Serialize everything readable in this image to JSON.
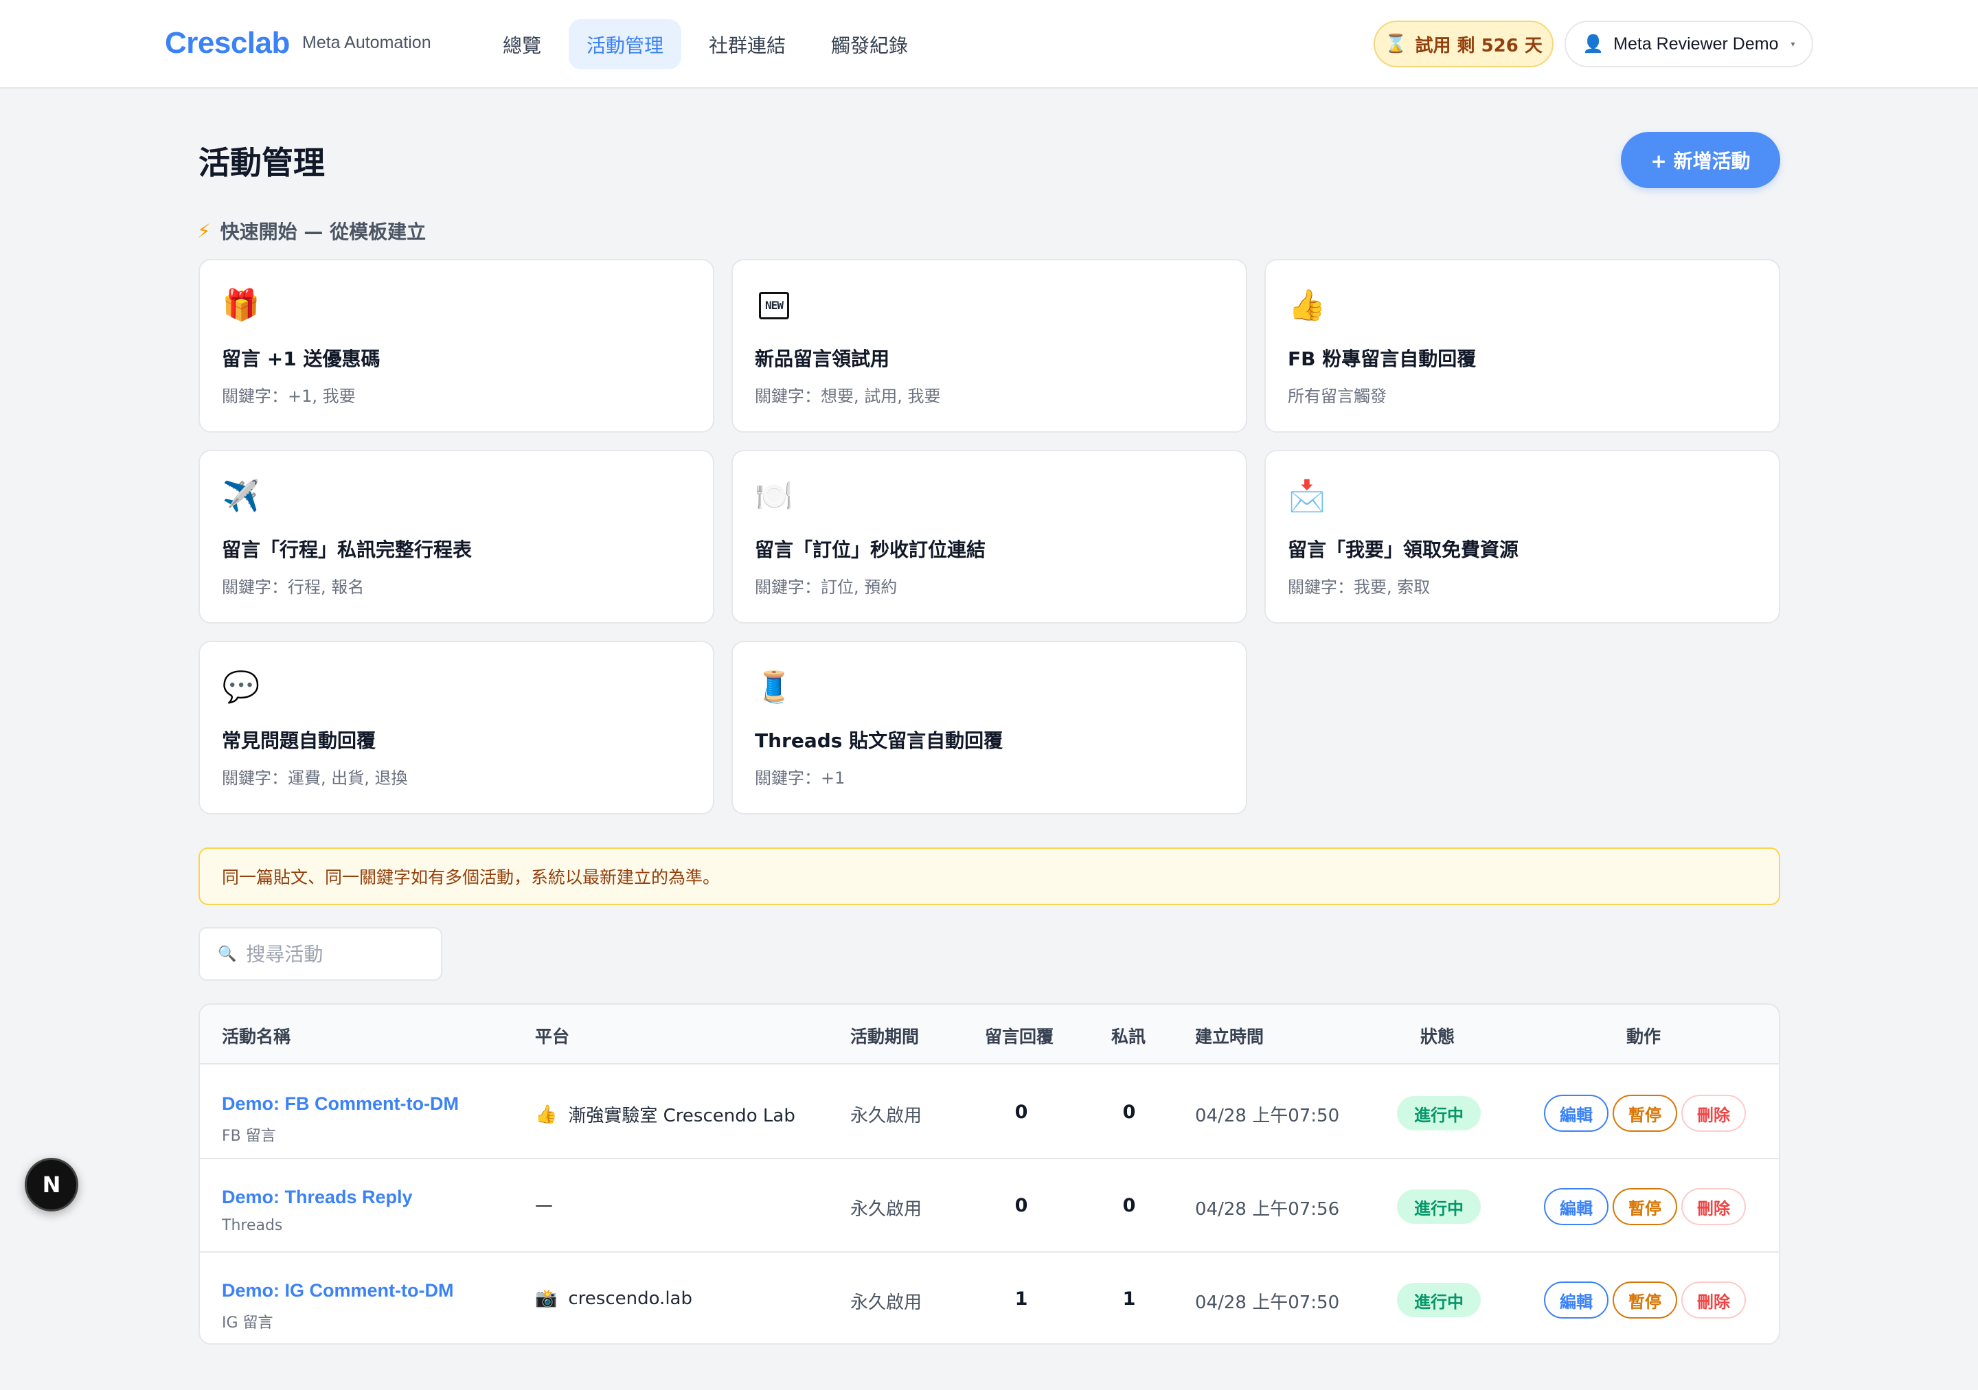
{
  "header": {
    "logo": "Cresclab",
    "logo_sub": "Meta Automation",
    "nav": [
      {
        "label": "總覽",
        "active": false
      },
      {
        "label": "活動管理",
        "active": true
      },
      {
        "label": "社群連結",
        "active": false
      },
      {
        "label": "觸發紀錄",
        "active": false
      }
    ],
    "trial_icon": "⌛",
    "trial_label": "試用 剩 526 天",
    "user_icon": "👤",
    "user_name": "Meta Reviewer Demo",
    "user_caret": "▾"
  },
  "page": {
    "title": "活動管理",
    "new_button": "+ 新增活動",
    "quick_icon": "⚡",
    "quick_title": "快速開始 — 從模板建立"
  },
  "templates": [
    {
      "icon": "🎁",
      "title": "留言 +1 送優惠碼",
      "keywords": "關鍵字：+1, 我要"
    },
    {
      "icon": "NEW",
      "title": "新品留言領試用",
      "keywords": "關鍵字：想要, 試用, 我要"
    },
    {
      "icon": "👍",
      "title": "FB 粉專留言自動回覆",
      "keywords": "所有留言觸發"
    },
    {
      "icon": "✈️",
      "title": "留言「行程」私訊完整行程表",
      "keywords": "關鍵字：行程, 報名"
    },
    {
      "icon": "🍽️",
      "title": "留言「訂位」秒收訂位連結",
      "keywords": "關鍵字：訂位, 預約"
    },
    {
      "icon": "📩",
      "title": "留言「我要」領取免費資源",
      "keywords": "關鍵字：我要, 索取"
    },
    {
      "icon": "💬",
      "title": "常見問題自動回覆",
      "keywords": "關鍵字：運費, 出貨, 退換"
    },
    {
      "icon": "🧵",
      "title": "Threads 貼文留言自動回覆",
      "keywords": "關鍵字：+1"
    }
  ],
  "notice": "同一篇貼文、同一關鍵字如有多個活動，系統以最新建立的為準。",
  "search": {
    "icon": "🔍",
    "placeholder": "搜尋活動"
  },
  "table": {
    "headers": [
      "活動名稱",
      "平台",
      "活動期間",
      "留言回覆",
      "私訊",
      "建立時間",
      "狀態",
      "動作"
    ],
    "rows": [
      {
        "name": "Demo: FB Comment-to-DM",
        "type": "FB 留言",
        "platform_icon": "👍",
        "platform": "漸強實驗室 Crescendo Lab",
        "period": "永久啟用",
        "replies": "0",
        "dms": "0",
        "created": "04/28 上午07:50",
        "status": "進行中"
      },
      {
        "name": "Demo: Threads Reply",
        "type": "Threads",
        "platform_icon": "",
        "platform": "—",
        "period": "永久啟用",
        "replies": "0",
        "dms": "0",
        "created": "04/28 上午07:56",
        "status": "進行中"
      },
      {
        "name": "Demo: IG Comment-to-DM",
        "type": "IG 留言",
        "platform_icon": "📸",
        "platform": "crescendo.lab",
        "period": "永久啟用",
        "replies": "1",
        "dms": "1",
        "created": "04/28 上午07:50",
        "status": "進行中"
      }
    ],
    "actions": {
      "edit": "編輯",
      "pause": "暫停",
      "delete": "刪除"
    }
  },
  "fab_label": "N",
  "colors": {
    "accent": "#3b82f6",
    "status_active": "#059669",
    "pause": "#d97706",
    "delete": "#ef4444"
  }
}
